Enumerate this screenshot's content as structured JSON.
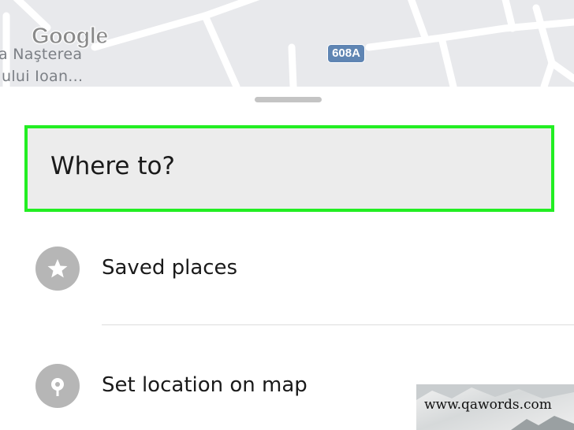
{
  "map": {
    "place_label_line1": "a Naşterea",
    "place_label_line2": "ului Ioan...",
    "route_badge": "608A",
    "logo_text": "Google"
  },
  "search": {
    "label": "Where to?",
    "highlight_color": "#22ee22"
  },
  "menu": {
    "items": [
      {
        "label": "Saved places",
        "icon": "star-icon"
      },
      {
        "label": "Set location on map",
        "icon": "map-pin-icon"
      }
    ]
  },
  "watermark": {
    "text": "www.qawords.com"
  }
}
